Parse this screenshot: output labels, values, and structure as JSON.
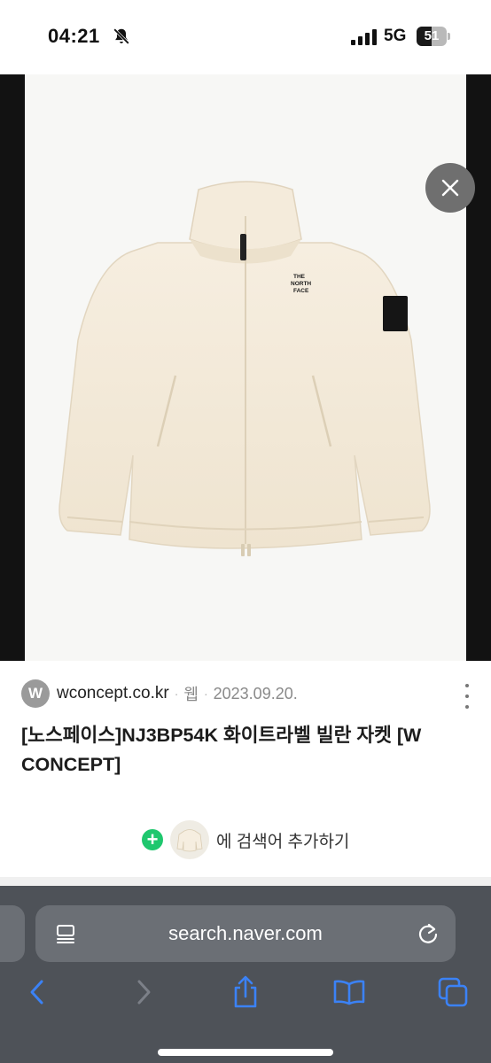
{
  "status_bar": {
    "time": "04:21",
    "network": "5G",
    "battery_percent": "51",
    "battery_level": 0.51
  },
  "result": {
    "site_initial": "W",
    "site_name": "wconcept.co.kr",
    "meta_type": "웹",
    "date": "2023.09.20.",
    "title": "[노스페이스]NJ3BP54K 화이트라벨 빌란 자켓 [W CONCEPT]",
    "add_search_label": "에 검색어 추가하기"
  },
  "image": {
    "logo_text": [
      "THE",
      "NORTH",
      "FACE"
    ]
  },
  "browser": {
    "url": "search.naver.com"
  },
  "colors": {
    "accent_blue": "#3b82f6",
    "plus_green": "#1fc76e",
    "jacket": "#f5ecdc"
  },
  "icons": [
    "bell-slash-icon",
    "signal-icon",
    "battery-icon",
    "close-icon",
    "lens-search-icon",
    "more-vertical-icon",
    "plus-icon",
    "reader-icon",
    "reload-icon",
    "back-icon",
    "forward-icon",
    "share-icon",
    "bookmarks-icon",
    "tabs-icon"
  ]
}
